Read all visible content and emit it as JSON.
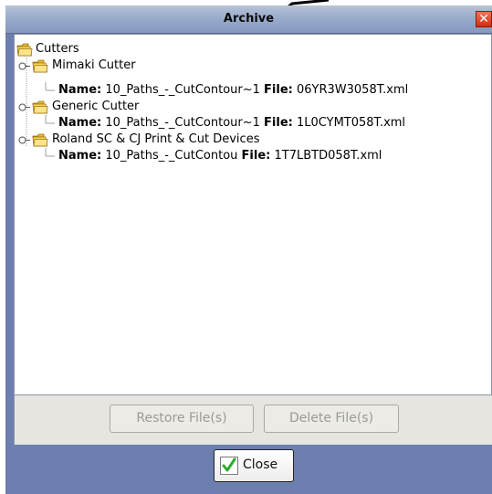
{
  "dialog": {
    "title": "Archive",
    "close_x_label": "✕"
  },
  "tree": {
    "root": {
      "label": "Cutters"
    },
    "nodes": [
      {
        "label": "Mimaki Cutter",
        "file": {
          "name_label": "Name:",
          "name": "10_Paths_-_CutContour~1",
          "file_label": "File:",
          "file": "06YR3W3058T.xml"
        }
      },
      {
        "label": "Generic Cutter",
        "file": {
          "name_label": "Name:",
          "name": "10_Paths_-_CutContour~1",
          "file_label": "File:",
          "file": "1L0CYMT058T.xml"
        }
      },
      {
        "label": "Roland SC & CJ Print & Cut Devices",
        "file": {
          "name_label": "Name:",
          "name": "10_Paths_-_CutContou",
          "file_label": "File:",
          "file": "1T7LBTD058T.xml"
        }
      }
    ]
  },
  "buttons": {
    "restore": "Restore File(s)",
    "delete": "Delete File(s)",
    "close": "Close"
  },
  "colors": {
    "titlebar": "#9aaccb",
    "dialog_bg": "#6d7fae",
    "button_band": "#e6e5df",
    "folder": "#f2c53d",
    "check": "#2eaa2e"
  }
}
